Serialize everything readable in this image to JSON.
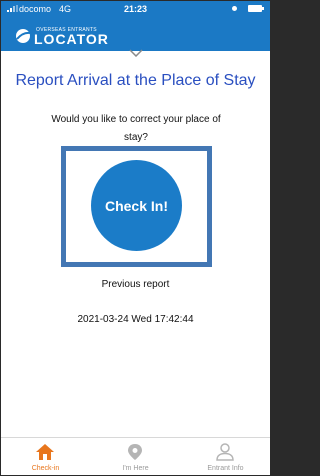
{
  "status_bar": {
    "carrier": "docomo",
    "network": "4G",
    "time": "21:23"
  },
  "app": {
    "logo_sub": "OVERSEAS ENTRANTS",
    "logo_main": "LOCATOR"
  },
  "main": {
    "title": "Report Arrival at the Place of Stay",
    "question": "Would you like to correct your place of stay?",
    "checkin_button_label": "Check In!",
    "previous_report_label": "Previous report",
    "previous_report_time": "2021-03-24 Wed 17:42:44"
  },
  "tabs": [
    {
      "label": "Check-in",
      "icon": "house-icon",
      "active": true
    },
    {
      "label": "I'm Here",
      "icon": "location-pin-icon",
      "active": false
    },
    {
      "label": "Entrant Info",
      "icon": "person-icon",
      "active": false
    }
  ],
  "colors": {
    "brand_blue": "#1b79c5",
    "title_blue": "#2a4fc0",
    "highlight_frame": "#4377b4",
    "active_tab": "#e8761d",
    "inactive_tab": "#9a9a9a"
  }
}
